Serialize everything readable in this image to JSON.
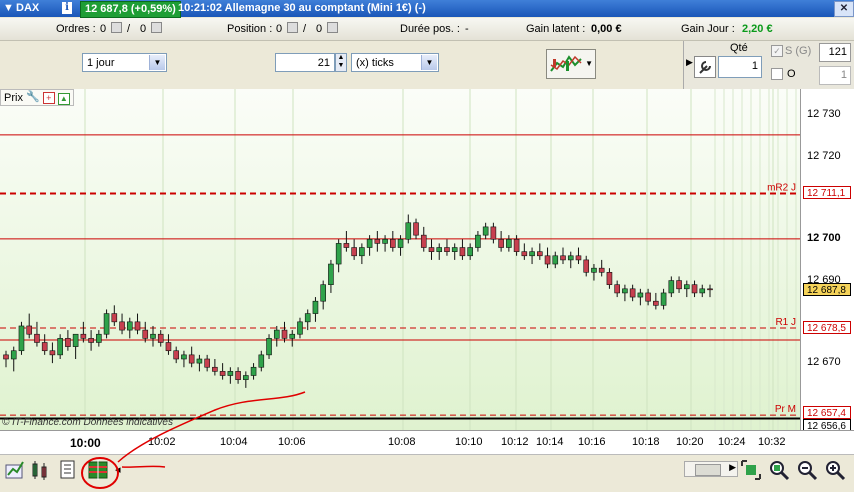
{
  "titlebar": {
    "instrument": "DAX",
    "price_change": "12 687,8 (+0,59%)",
    "title_text": "10:21:02 Allemagne 30 au comptant (Mini 1€) (-)",
    "info_icon": "i",
    "close_icon": "close-icon"
  },
  "infobar": {
    "orders_label": "Ordres :",
    "orders_value": "0",
    "orders_value2": "0",
    "position_label": "Position :",
    "position_value": "0",
    "position_value2": "0",
    "duration_label": "Durée pos. :",
    "duration_value": "-",
    "latent_label": "Gain latent :",
    "latent_value": "0,00 €",
    "day_gain_label": "Gain Jour :",
    "day_gain_value": "2,20 €"
  },
  "toolbar": {
    "period_value": "1 jour",
    "units_value": "21",
    "units_type_value": "(x) ticks",
    "qty_label": "Qté",
    "qty_value": "1",
    "sg_label": "S (G)",
    "sg_value": "121",
    "o_label": "O",
    "o_value": "1"
  },
  "chart_header": {
    "prix_label": "Prix"
  },
  "chart_data": {
    "type": "candlestick",
    "y_axis": {
      "ticks": [
        "12 730",
        "12 720",
        "12 700",
        "12 690",
        "12 670"
      ],
      "range": [
        12655,
        12735
      ]
    },
    "x_axis": {
      "ticks": [
        "10:00",
        "10:02",
        "10:04",
        "10:06",
        "10:08",
        "10:10",
        "10:12",
        "10:14",
        "10:16",
        "10:18",
        "10:20",
        "10:24",
        "10:32"
      ]
    },
    "price_labels": [
      {
        "text": "12 711,1",
        "color": "#cc0000"
      },
      {
        "text": "12 687,8",
        "color": "#000000"
      },
      {
        "text": "12 678,5",
        "color": "#cc0000"
      },
      {
        "text": "12 657,4",
        "color": "#cc0000"
      },
      {
        "text": "12 656,6",
        "color": "#000000"
      }
    ],
    "level_labels": [
      {
        "text": "mR2 J",
        "value": 12711.1
      },
      {
        "text": "R1 J",
        "value": 12678.5
      },
      {
        "text": "Pr M",
        "value": 12657.4
      }
    ],
    "solid_levels": [
      12725.3,
      12700.1,
      12675.6,
      12656.6
    ],
    "current_price": 12687.8,
    "candles": [
      [
        12672,
        12673,
        12669,
        12671
      ],
      [
        12671,
        12674,
        12668,
        12673
      ],
      [
        12673,
        12680,
        12672,
        12679
      ],
      [
        12679,
        12682,
        12676,
        12677
      ],
      [
        12677,
        12680,
        12674,
        12675
      ],
      [
        12675,
        12677,
        12672,
        12673
      ],
      [
        12673,
        12675,
        12670,
        12672
      ],
      [
        12672,
        12677,
        12671,
        12676
      ],
      [
        12676,
        12678,
        12673,
        12674
      ],
      [
        12674,
        12677,
        12671,
        12677
      ],
      [
        12677,
        12680,
        12675,
        12676
      ],
      [
        12676,
        12678,
        12673,
        12675
      ],
      [
        12675,
        12678,
        12674,
        12677
      ],
      [
        12677,
        12683,
        12676,
        12682
      ],
      [
        12682,
        12684,
        12679,
        12680
      ],
      [
        12680,
        12682,
        12677,
        12678
      ],
      [
        12678,
        12681,
        12676,
        12680
      ],
      [
        12680,
        12682,
        12677,
        12678
      ],
      [
        12678,
        12680,
        12675,
        12676
      ],
      [
        12676,
        12679,
        12674,
        12677
      ],
      [
        12677,
        12678,
        12674,
        12675
      ],
      [
        12675,
        12677,
        12672,
        12673
      ],
      [
        12673,
        12674,
        12670,
        12671
      ],
      [
        12671,
        12673,
        12669,
        12672
      ],
      [
        12672,
        12674,
        12669,
        12670
      ],
      [
        12670,
        12672,
        12668,
        12671
      ],
      [
        12671,
        12672,
        12668,
        12669
      ],
      [
        12669,
        12671,
        12667,
        12668
      ],
      [
        12668,
        12670,
        12666,
        12667
      ],
      [
        12667,
        12669,
        12665,
        12668
      ],
      [
        12668,
        12669,
        12665,
        12666
      ],
      [
        12666,
        12668,
        12664,
        12667
      ],
      [
        12667,
        12670,
        12666,
        12669
      ],
      [
        12669,
        12673,
        12668,
        12672
      ],
      [
        12672,
        12677,
        12671,
        12676
      ],
      [
        12676,
        12679,
        12674,
        12678
      ],
      [
        12678,
        12680,
        12675,
        12676
      ],
      [
        12676,
        12678,
        12674,
        12677
      ],
      [
        12677,
        12681,
        12676,
        12680
      ],
      [
        12680,
        12683,
        12678,
        12682
      ],
      [
        12682,
        12686,
        12680,
        12685
      ],
      [
        12685,
        12690,
        12683,
        12689
      ],
      [
        12689,
        12695,
        12687,
        12694
      ],
      [
        12694,
        12700,
        12692,
        12699
      ],
      [
        12699,
        12702,
        12697,
        12698
      ],
      [
        12698,
        12700,
        12695,
        12696
      ],
      [
        12696,
        12699,
        12694,
        12698
      ],
      [
        12698,
        12701,
        12696,
        12700
      ],
      [
        12700,
        12702,
        12697,
        12699
      ],
      [
        12699,
        12701,
        12697,
        12700
      ],
      [
        12700,
        12702,
        12697,
        12698
      ],
      [
        12698,
        12701,
        12696,
        12700
      ],
      [
        12700,
        12706,
        12699,
        12704
      ],
      [
        12704,
        12705,
        12700,
        12701
      ],
      [
        12701,
        12703,
        12697,
        12698
      ],
      [
        12698,
        12700,
        12695,
        12697
      ],
      [
        12697,
        12699,
        12695,
        12698
      ],
      [
        12698,
        12700,
        12696,
        12697
      ],
      [
        12697,
        12699,
        12695,
        12698
      ],
      [
        12698,
        12700,
        12695,
        12696
      ],
      [
        12696,
        12699,
        12695,
        12698
      ],
      [
        12698,
        12702,
        12697,
        12701
      ],
      [
        12701,
        12704,
        12700,
        12703
      ],
      [
        12703,
        12704,
        12699,
        12700
      ],
      [
        12700,
        12702,
        12697,
        12698
      ],
      [
        12698,
        12701,
        12697,
        12700
      ],
      [
        12700,
        12701,
        12696,
        12697
      ],
      [
        12697,
        12699,
        12695,
        12696
      ],
      [
        12696,
        12698,
        12694,
        12697
      ],
      [
        12697,
        12699,
        12695,
        12696
      ],
      [
        12696,
        12698,
        12693,
        12694
      ],
      [
        12694,
        12697,
        12693,
        12696
      ],
      [
        12696,
        12698,
        12694,
        12695
      ],
      [
        12695,
        12697,
        12693,
        12696
      ],
      [
        12696,
        12698,
        12694,
        12695
      ],
      [
        12695,
        12696,
        12691,
        12692
      ],
      [
        12692,
        12694,
        12690,
        12693
      ],
      [
        12693,
        12695,
        12691,
        12692
      ],
      [
        12692,
        12693,
        12688,
        12689
      ],
      [
        12689,
        12690,
        12686,
        12687
      ],
      [
        12687,
        12689,
        12685,
        12688
      ],
      [
        12688,
        12689,
        12685,
        12686
      ],
      [
        12686,
        12688,
        12684,
        12687
      ],
      [
        12687,
        12688,
        12684,
        12685
      ],
      [
        12685,
        12687,
        12683,
        12684
      ],
      [
        12684,
        12688,
        12683,
        12687
      ],
      [
        12687,
        12691,
        12686,
        12690
      ],
      [
        12690,
        12691,
        12687,
        12688
      ],
      [
        12688,
        12690,
        12686,
        12689
      ],
      [
        12689,
        12690,
        12686,
        12687
      ],
      [
        12687,
        12689,
        12686,
        12688
      ],
      [
        12688,
        12689,
        12686,
        12687.8
      ]
    ]
  },
  "footer": {
    "watermark": "© IT-Finance.com  Données indicatives"
  },
  "colors": {
    "up_candle": "#2fa24a",
    "down_candle": "#c7404f",
    "level_red": "#cc0000",
    "titlebar_price_bg": "#1e9e35",
    "annotation_red": "#e00000"
  },
  "bottombar": {
    "icons": [
      "chart-export-icon",
      "indicators-icon",
      "orders-list-icon",
      "grid-icon",
      "zoom-fit-icon",
      "zoom-reset-icon",
      "zoom-out-icon",
      "zoom-in-icon"
    ]
  }
}
